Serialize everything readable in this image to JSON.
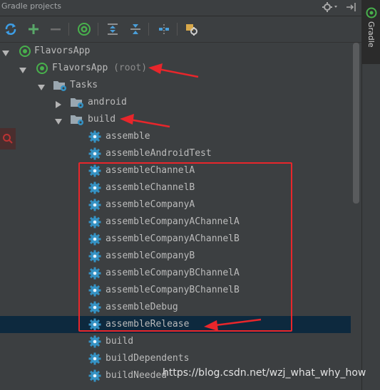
{
  "header": {
    "title": "Gradle projects"
  },
  "toolbar": {
    "buttons": [
      "refresh-icon",
      "add-icon",
      "remove-icon",
      "execute-task-icon",
      "expand-all-icon",
      "collapse-all-icon",
      "toggle-offline-icon",
      "settings-icon"
    ]
  },
  "side_tab": {
    "label": "Gradle"
  },
  "tree": {
    "project": "FlavorsApp",
    "module": "FlavorsApp",
    "module_suffix": "(root)",
    "tasks_folder": "Tasks",
    "groups": [
      "android",
      "build"
    ],
    "build_tasks": [
      "assemble",
      "assembleAndroidTest",
      "assembleChannelA",
      "assembleChannelB",
      "assembleCompanyA",
      "assembleCompanyAChannelA",
      "assembleCompanyAChannelB",
      "assembleCompanyB",
      "assembleCompanyBChannelA",
      "assembleCompanyBChannelB",
      "assembleDebug",
      "assembleRelease",
      "build",
      "buildDependents",
      "buildNeeded"
    ],
    "selected_task": "assembleRelease"
  },
  "watermark": "https://blog.csdn.net/wzj_what_why_how",
  "colors": {
    "background": "#3c3f41",
    "selection": "#0d293e",
    "annotation_red": "#e8262b",
    "gradle_green": "#48b04c",
    "task_gear_blue": "#3592c4"
  }
}
